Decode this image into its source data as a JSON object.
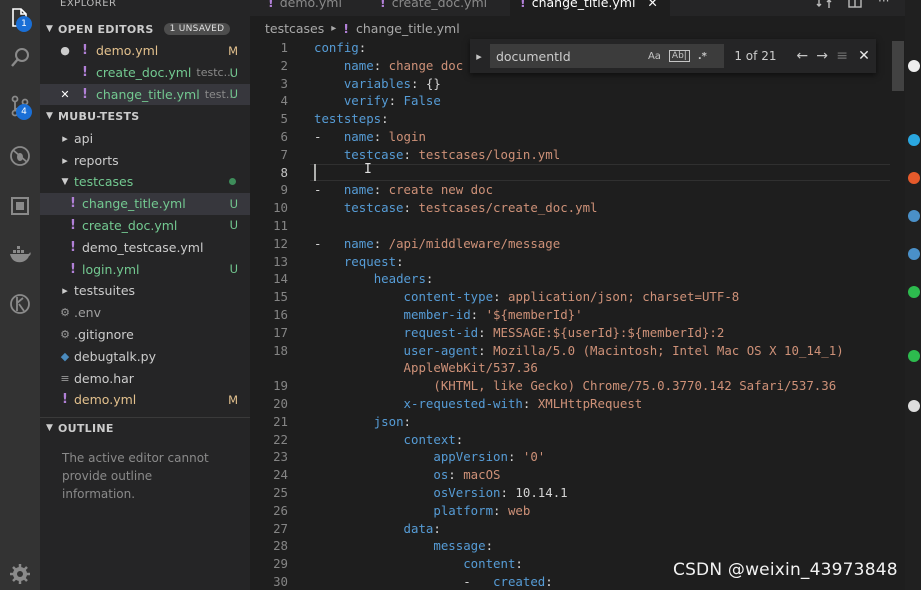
{
  "activity": {
    "explorer_badge": "1",
    "scm_badge": "4"
  },
  "sidebar": {
    "title": "EXPLORER",
    "open_editors": {
      "title": "OPEN EDITORS",
      "unsaved": "1 UNSAVED",
      "items": [
        {
          "name": "demo.yml",
          "sub": "",
          "status": "M",
          "lead": "●"
        },
        {
          "name": "create_doc.yml",
          "sub": "testc...",
          "status": "U",
          "lead": ""
        },
        {
          "name": "change_title.yml",
          "sub": "test...",
          "status": "U",
          "lead": "✕"
        }
      ]
    },
    "workspace": {
      "title": "MUBU-TESTS",
      "items": [
        {
          "name": "api"
        },
        {
          "name": "reports"
        },
        {
          "name": "testcases"
        },
        {
          "name": "change_title.yml",
          "status": "U"
        },
        {
          "name": "create_doc.yml",
          "status": "U"
        },
        {
          "name": "demo_testcase.yml"
        },
        {
          "name": "login.yml",
          "status": "U"
        },
        {
          "name": "testsuites"
        },
        {
          "name": ".env"
        },
        {
          "name": ".gitignore"
        },
        {
          "name": "debugtalk.py"
        },
        {
          "name": "demo.har"
        },
        {
          "name": "demo.yml",
          "status": "M"
        }
      ]
    },
    "outline": {
      "title": "OUTLINE",
      "message": "The active editor cannot provide outline information."
    }
  },
  "tabs": [
    {
      "label": "demo.yml"
    },
    {
      "label": "create_doc.yml"
    },
    {
      "label": "change_title.yml",
      "close": "✕"
    }
  ],
  "breadcrumb": {
    "folder": "testcases",
    "file": "change_title.yml"
  },
  "find": {
    "value": "documentId",
    "case_opt": "Aa",
    "word_opt": "Ab|",
    "regex_opt": ".*",
    "count": "1 of 21",
    "prev": "←",
    "next": "→",
    "selection": "≡",
    "close": "✕"
  },
  "editor": {
    "lines": [
      {
        "n": "1",
        "t": [
          [
            "k",
            "config"
          ],
          [
            "p",
            ":"
          ]
        ]
      },
      {
        "n": "2",
        "t": [
          [
            "p",
            "    "
          ],
          [
            "k",
            "name"
          ],
          [
            "p",
            ": "
          ],
          [
            "v",
            "change doc t"
          ]
        ]
      },
      {
        "n": "3",
        "t": [
          [
            "p",
            "    "
          ],
          [
            "k",
            "variables"
          ],
          [
            "p",
            ": {}"
          ]
        ]
      },
      {
        "n": "4",
        "t": [
          [
            "p",
            "    "
          ],
          [
            "k",
            "verify"
          ],
          [
            "p",
            ": "
          ],
          [
            "c",
            "False"
          ]
        ]
      },
      {
        "n": "5",
        "t": [
          [
            "k",
            "teststeps"
          ],
          [
            "p",
            ":"
          ]
        ]
      },
      {
        "n": "6",
        "t": [
          [
            "p",
            "-   "
          ],
          [
            "k",
            "name"
          ],
          [
            "p",
            ": "
          ],
          [
            "v",
            "login"
          ]
        ]
      },
      {
        "n": "7",
        "t": [
          [
            "p",
            "    "
          ],
          [
            "k",
            "testcase"
          ],
          [
            "p",
            ": "
          ],
          [
            "v",
            "testcases/login.yml"
          ]
        ]
      },
      {
        "n": "8",
        "t": []
      },
      {
        "n": "9",
        "t": [
          [
            "p",
            "-   "
          ],
          [
            "k",
            "name"
          ],
          [
            "p",
            ": "
          ],
          [
            "v",
            "create new doc"
          ]
        ]
      },
      {
        "n": "10",
        "t": [
          [
            "p",
            "    "
          ],
          [
            "k",
            "testcase"
          ],
          [
            "p",
            ": "
          ],
          [
            "v",
            "testcases/create_doc.yml"
          ]
        ]
      },
      {
        "n": "11",
        "t": []
      },
      {
        "n": "12",
        "t": [
          [
            "p",
            "-   "
          ],
          [
            "k",
            "name"
          ],
          [
            "p",
            ": "
          ],
          [
            "v",
            "/api/middleware/message"
          ]
        ]
      },
      {
        "n": "13",
        "t": [
          [
            "p",
            "    "
          ],
          [
            "k",
            "request"
          ],
          [
            "p",
            ":"
          ]
        ]
      },
      {
        "n": "14",
        "t": [
          [
            "p",
            "        "
          ],
          [
            "k",
            "headers"
          ],
          [
            "p",
            ":"
          ]
        ]
      },
      {
        "n": "15",
        "t": [
          [
            "p",
            "            "
          ],
          [
            "k",
            "content-type"
          ],
          [
            "p",
            ": "
          ],
          [
            "v",
            "application/json; charset=UTF-8"
          ]
        ]
      },
      {
        "n": "16",
        "t": [
          [
            "p",
            "            "
          ],
          [
            "k",
            "member-id"
          ],
          [
            "p",
            ": "
          ],
          [
            "v",
            "'${memberId}'"
          ]
        ]
      },
      {
        "n": "17",
        "t": [
          [
            "p",
            "            "
          ],
          [
            "k",
            "request-id"
          ],
          [
            "p",
            ": "
          ],
          [
            "v",
            "MESSAGE:${userId}:${memberId}:2"
          ]
        ]
      },
      {
        "n": "18",
        "t": [
          [
            "p",
            "            "
          ],
          [
            "k",
            "user-agent"
          ],
          [
            "p",
            ": "
          ],
          [
            "v",
            "Mozilla/5.0 (Macintosh; Intel Mac OS X 10_14_1)"
          ]
        ]
      },
      {
        "n": "",
        "t": [
          [
            "p",
            "            "
          ],
          [
            "v",
            "AppleWebKit/537.36"
          ]
        ]
      },
      {
        "n": "19",
        "t": [
          [
            "p",
            "                "
          ],
          [
            "v",
            "(KHTML, like Gecko) Chrome/75.0.3770.142 Safari/537.36"
          ]
        ]
      },
      {
        "n": "20",
        "t": [
          [
            "p",
            "            "
          ],
          [
            "k",
            "x-requested-with"
          ],
          [
            "p",
            ": "
          ],
          [
            "v",
            "XMLHttpRequest"
          ]
        ]
      },
      {
        "n": "21",
        "t": [
          [
            "p",
            "        "
          ],
          [
            "k",
            "json"
          ],
          [
            "p",
            ":"
          ]
        ]
      },
      {
        "n": "22",
        "t": [
          [
            "p",
            "            "
          ],
          [
            "k",
            "context"
          ],
          [
            "p",
            ":"
          ]
        ]
      },
      {
        "n": "23",
        "t": [
          [
            "p",
            "                "
          ],
          [
            "k",
            "appVersion"
          ],
          [
            "p",
            ": "
          ],
          [
            "v",
            "'0'"
          ]
        ]
      },
      {
        "n": "24",
        "t": [
          [
            "p",
            "                "
          ],
          [
            "k",
            "os"
          ],
          [
            "p",
            ": "
          ],
          [
            "v",
            "macOS"
          ]
        ]
      },
      {
        "n": "25",
        "t": [
          [
            "p",
            "                "
          ],
          [
            "k",
            "osVersion"
          ],
          [
            "p",
            ": 10.14.1"
          ]
        ]
      },
      {
        "n": "26",
        "t": [
          [
            "p",
            "                "
          ],
          [
            "k",
            "platform"
          ],
          [
            "p",
            ": "
          ],
          [
            "v",
            "web"
          ]
        ]
      },
      {
        "n": "27",
        "t": [
          [
            "p",
            "            "
          ],
          [
            "k",
            "data"
          ],
          [
            "p",
            ":"
          ]
        ]
      },
      {
        "n": "28",
        "t": [
          [
            "p",
            "                "
          ],
          [
            "k",
            "message"
          ],
          [
            "p",
            ":"
          ]
        ]
      },
      {
        "n": "29",
        "t": [
          [
            "p",
            "                    "
          ],
          [
            "k",
            "content"
          ],
          [
            "p",
            ":"
          ]
        ]
      },
      {
        "n": "30",
        "t": [
          [
            "p",
            "                    -   "
          ],
          [
            "k",
            "created"
          ],
          [
            "p",
            ":"
          ]
        ]
      }
    ]
  },
  "watermark": "CSDN @weixin_43973848"
}
